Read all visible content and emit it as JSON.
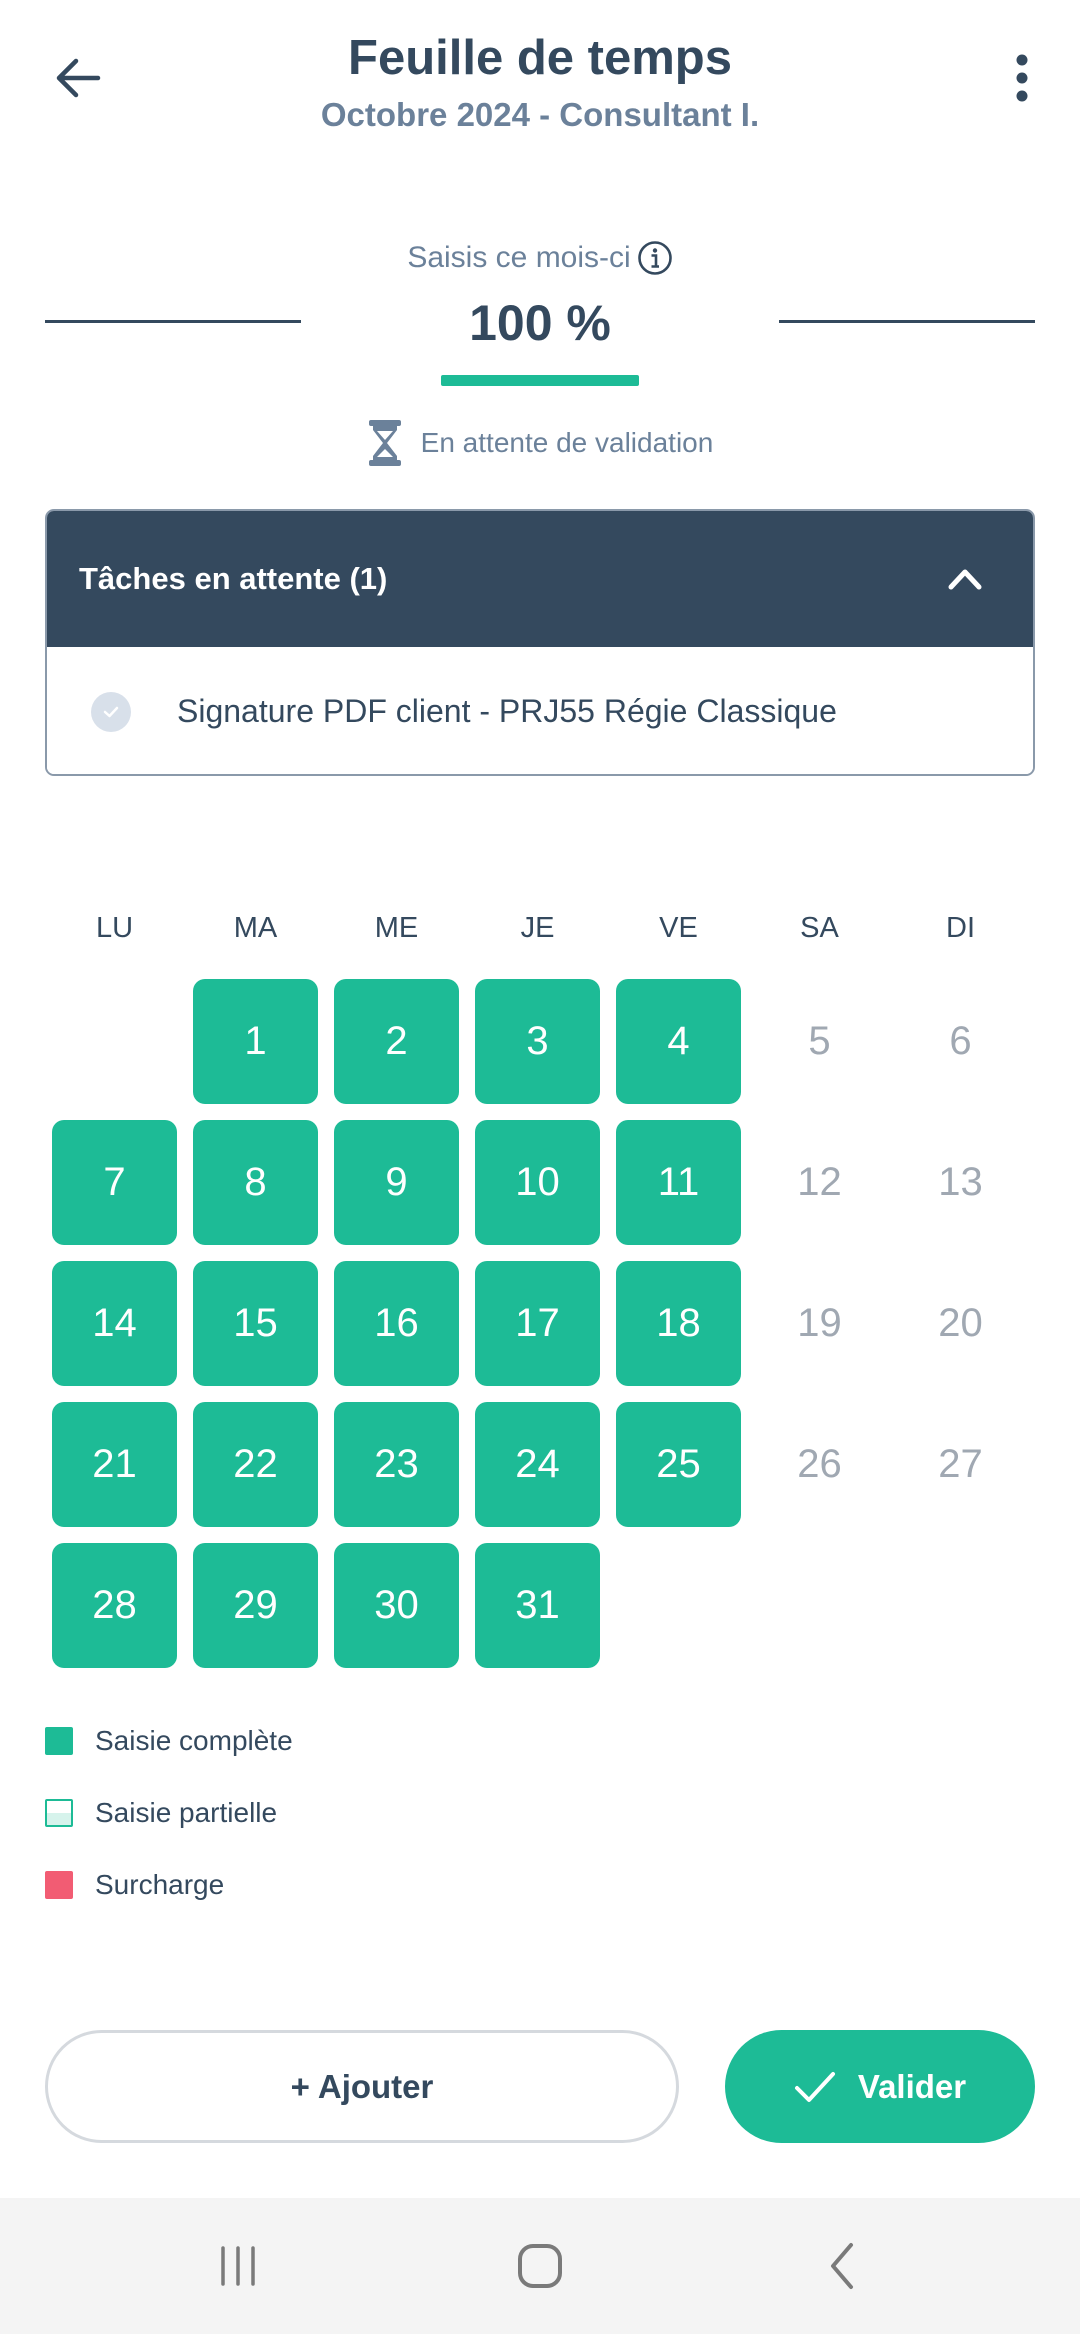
{
  "header": {
    "title": "Feuille de temps",
    "subtitle": "Octobre 2024 - Consultant I."
  },
  "progress": {
    "label": "Saisis ce mois-ci",
    "value_text": "100 %",
    "fraction": 1.0,
    "status": "En attente de validation"
  },
  "tasks": {
    "title": "Tâches en attente (1)",
    "expanded": true,
    "items": [
      {
        "label": "Signature PDF client - PRJ55 Régie Classique"
      }
    ]
  },
  "calendar": {
    "weekdays": [
      "LU",
      "MA",
      "ME",
      "JE",
      "VE",
      "SA",
      "DI"
    ],
    "weeks": [
      [
        null,
        {
          "d": "1",
          "s": "full"
        },
        {
          "d": "2",
          "s": "full"
        },
        {
          "d": "3",
          "s": "full"
        },
        {
          "d": "4",
          "s": "full"
        },
        {
          "d": "5",
          "s": "weekend"
        },
        {
          "d": "6",
          "s": "weekend"
        }
      ],
      [
        {
          "d": "7",
          "s": "full"
        },
        {
          "d": "8",
          "s": "full"
        },
        {
          "d": "9",
          "s": "full"
        },
        {
          "d": "10",
          "s": "full"
        },
        {
          "d": "11",
          "s": "full"
        },
        {
          "d": "12",
          "s": "weekend"
        },
        {
          "d": "13",
          "s": "weekend"
        }
      ],
      [
        {
          "d": "14",
          "s": "full"
        },
        {
          "d": "15",
          "s": "full"
        },
        {
          "d": "16",
          "s": "full"
        },
        {
          "d": "17",
          "s": "full"
        },
        {
          "d": "18",
          "s": "full"
        },
        {
          "d": "19",
          "s": "weekend"
        },
        {
          "d": "20",
          "s": "weekend"
        }
      ],
      [
        {
          "d": "21",
          "s": "full"
        },
        {
          "d": "22",
          "s": "full"
        },
        {
          "d": "23",
          "s": "full"
        },
        {
          "d": "24",
          "s": "full"
        },
        {
          "d": "25",
          "s": "full"
        },
        {
          "d": "26",
          "s": "weekend"
        },
        {
          "d": "27",
          "s": "weekend"
        }
      ],
      [
        {
          "d": "28",
          "s": "full"
        },
        {
          "d": "29",
          "s": "full"
        },
        {
          "d": "30",
          "s": "full"
        },
        {
          "d": "31",
          "s": "full"
        },
        null,
        null,
        null
      ]
    ]
  },
  "legend": {
    "complete": "Saisie complète",
    "partial": "Saisie partielle",
    "overload": "Surcharge"
  },
  "actions": {
    "add_label": "+ Ajouter",
    "validate_label": "Valider"
  },
  "colors": {
    "accent": "#1dbb96",
    "primary_dark": "#34495e",
    "muted": "#6b819a",
    "overload": "#f25c73"
  },
  "icons": {
    "back": "arrow-left-icon",
    "menu": "more-vertical-icon",
    "info": "info-icon",
    "status": "hourglass-icon",
    "collapse": "chevron-up-icon",
    "task": "check-circle-icon",
    "validate": "check-icon"
  }
}
